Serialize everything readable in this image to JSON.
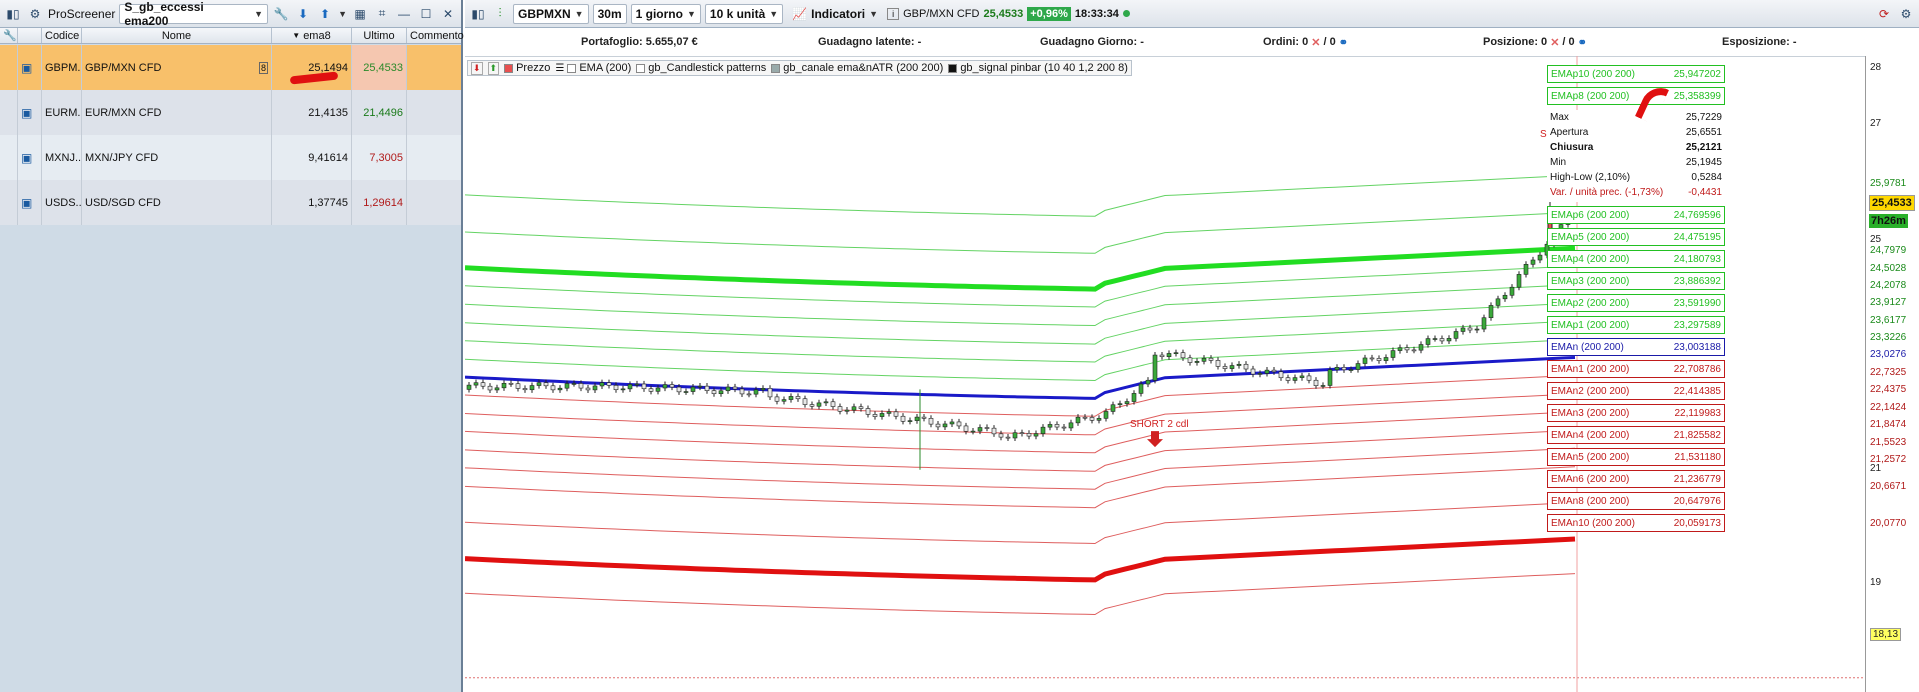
{
  "screener": {
    "title": "ProScreener",
    "selected": "S_gb_eccessi ema200"
  },
  "table": {
    "headers": {
      "code": "Codice",
      "name": "Nome",
      "ema": "ema8",
      "last": "Ultimo",
      "comment": "Commento"
    },
    "rows": [
      {
        "code": "GBPM...",
        "name": "GBP/MXN CFD",
        "ema": "25,1494",
        "last": "25,4533"
      },
      {
        "code": "EURM...",
        "name": "EUR/MXN CFD",
        "ema": "21,4135",
        "last": "21,4496"
      },
      {
        "code": "MXNJ...",
        "name": "MXN/JPY CFD",
        "ema": "9,41614",
        "last": "7,3005"
      },
      {
        "code": "USDS...",
        "name": "USD/SGD CFD",
        "ema": "1,37745",
        "last": "1,29614"
      }
    ]
  },
  "chart_toolbar": {
    "symbol": "GBPMXN",
    "timeframe": "30m",
    "period": "1 giorno",
    "units": "10 k unità",
    "indicators": "Indicatori",
    "instrument": "GBP/MXN CFD",
    "price": "25,4533",
    "change": "+0,96%",
    "time": "18:33:34"
  },
  "account": {
    "portafoglio": "Portafoglio: 5.655,07 €",
    "latente": "Guadagno latente: -",
    "giorno": "Guadagno Giorno: -",
    "ordini": "Ordini: 0",
    "ordini2": "/ 0",
    "posizione": "Posizione: 0",
    "posizione2": "/ 0",
    "esposizione": "Esposizione: -"
  },
  "legend": [
    "Prezzo",
    "EMA (200)",
    "gb_Candlestick patterns",
    "gb_canale ema&nATR (200 200)",
    "gb_signal pinbar (10 40 1,2 200 8)"
  ],
  "ema_boxes": [
    {
      "name": "EMAp10 (200 200)",
      "value": "25,947202",
      "color": "#22c022"
    },
    {
      "name": "EMAp8 (200 200)",
      "value": "25,358399",
      "color": "#22c022"
    },
    {
      "name": "EMAp6 (200 200)",
      "value": "24,769596",
      "color": "#22c022"
    },
    {
      "name": "EMAp5 (200 200)",
      "value": "24,475195",
      "color": "#22c022"
    },
    {
      "name": "EMAp4 (200 200)",
      "value": "24,180793",
      "color": "#22c022"
    },
    {
      "name": "EMAp3 (200 200)",
      "value": "23,886392",
      "color": "#22c022"
    },
    {
      "name": "EMAp2 (200 200)",
      "value": "23,591990",
      "color": "#22c022"
    },
    {
      "name": "EMAp1 (200 200)",
      "value": "23,297589",
      "color": "#22c022"
    },
    {
      "name": "EMAn (200 200)",
      "value": "23,003188",
      "color": "#1a1aa8"
    },
    {
      "name": "EMAn1 (200 200)",
      "value": "22,708786",
      "color": "#c01a1a"
    },
    {
      "name": "EMAn2 (200 200)",
      "value": "22,414385",
      "color": "#c01a1a"
    },
    {
      "name": "EMAn3 (200 200)",
      "value": "22,119983",
      "color": "#c01a1a"
    },
    {
      "name": "EMAn4 (200 200)",
      "value": "21,825582",
      "color": "#c01a1a"
    },
    {
      "name": "EMAn5 (200 200)",
      "value": "21,531180",
      "color": "#c01a1a"
    },
    {
      "name": "EMAn6 (200 200)",
      "value": "21,236779",
      "color": "#c01a1a"
    },
    {
      "name": "EMAn8 (200 200)",
      "value": "20,647976",
      "color": "#c01a1a"
    },
    {
      "name": "EMAn10 (200 200)",
      "value": "20,059173",
      "color": "#c01a1a"
    }
  ],
  "infobox": [
    {
      "label": "Max",
      "value": "25,7229"
    },
    {
      "label": "Apertura",
      "value": "25,6551"
    },
    {
      "label": "Chiusura",
      "value": "25,2121"
    },
    {
      "label": "Min",
      "value": "25,1945"
    },
    {
      "label": "High-Low (2,10%)",
      "value": "0,5284"
    },
    {
      "label": "Var. / unità prec. (-1,73%)",
      "value": "-0,4431"
    }
  ],
  "annotations": [
    "SHORT 2 cdl",
    "SHORT 2 cdl"
  ],
  "y_axis": [
    "28",
    "27",
    "25,9781",
    "25",
    "24,7979",
    "24,5028",
    "24,2078",
    "23,9127",
    "23,6177",
    "23,3226",
    "23,0276",
    "22,7325",
    "22,4375",
    "22,1424",
    "21,8474",
    "21,5523",
    "21,2572",
    "21",
    "20,6671",
    "20,0770",
    "19",
    "18,13"
  ],
  "price_tag": "25,4533",
  "time_tag": "7h26m",
  "chart_data": {
    "type": "line",
    "title": "",
    "series": [
      {
        "name": "EMA (200)"
      }
    ],
    "ylim": [
      17.9,
      28.2
    ]
  }
}
